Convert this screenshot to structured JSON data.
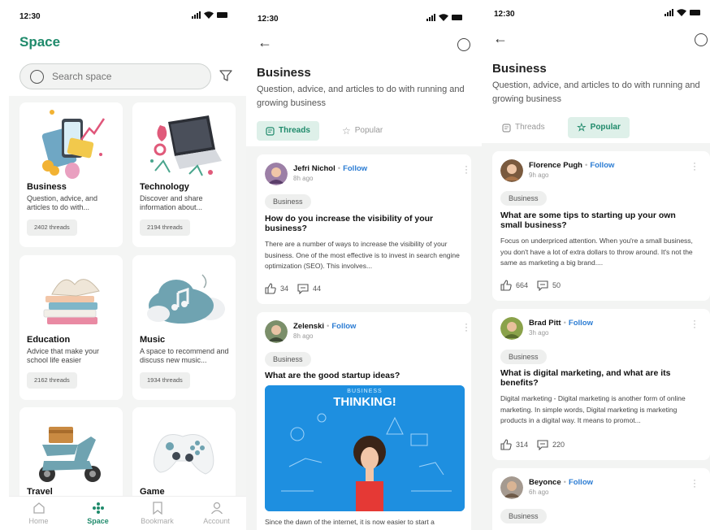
{
  "status_time": "12:30",
  "screen_space": {
    "title": "Space",
    "search_placeholder": "Search space",
    "cards": [
      {
        "title": "Business",
        "desc": "Question, advice, and articles to do with...",
        "threads": "2402 threads"
      },
      {
        "title": "Technology",
        "desc": "Discover and share information about...",
        "threads": "2194 threads"
      },
      {
        "title": "Education",
        "desc": "Advice that make your school life easier",
        "threads": "2162 threads"
      },
      {
        "title": "Music",
        "desc": "A space to recommend and discuss new music...",
        "threads": "1934 threads"
      },
      {
        "title": "Travel",
        "desc": "",
        "threads": ""
      },
      {
        "title": "Game",
        "desc": "",
        "threads": ""
      }
    ],
    "tabs": [
      {
        "label": "Home",
        "active": false
      },
      {
        "label": "Space",
        "active": true
      },
      {
        "label": "Bookmark",
        "active": false
      },
      {
        "label": "Account",
        "active": false
      }
    ]
  },
  "screen_threads": {
    "title": "Business",
    "subtitle": "Question, advice, and articles to do with running and growing business",
    "tab_threads": "Threads",
    "tab_popular": "Popular",
    "posts": [
      {
        "author": "Jefri Nichol",
        "follow": "Follow",
        "time": "8h ago",
        "tag": "Business",
        "title": "How do you increase the visibility of your business?",
        "body": "There are a number of ways to increase the visibility of your business. One of the most effective is to invest in search engine optimization (SEO). This involves...",
        "likes": "34",
        "comments": "44"
      },
      {
        "author": "Zelenski",
        "follow": "Follow",
        "time": "8h ago",
        "tag": "Business",
        "title": "What are the good startup ideas?",
        "image_caption": "BUSINESS",
        "image_heading": "THINKING!",
        "body": "Since the dawn of the internet, it is now easier to start a"
      }
    ]
  },
  "screen_popular": {
    "title": "Business",
    "subtitle": "Question, advice, and articles to do with running and growing business",
    "tab_threads": "Threads",
    "tab_popular": "Popular",
    "posts": [
      {
        "author": "Florence Pugh",
        "follow": "Follow",
        "time": "9h ago",
        "tag": "Business",
        "title": "What are some tips to starting up your own small business?",
        "body": "Focus on underpriced attention. When you're a small business, you don't have a lot of extra dollars to throw around. It's not the same as marketing a big brand....",
        "likes": "664",
        "comments": "50"
      },
      {
        "author": "Brad Pitt",
        "follow": "Follow",
        "time": "3h ago",
        "tag": "Business",
        "title": "What is digital marketing, and what are its benefits?",
        "body": "Digital marketing - Digital marketing is another form of online marketing. In simple words, Digital marketing is marketing products in a digital way. It means to promot...",
        "likes": "314",
        "comments": "220"
      },
      {
        "author": "Beyonce",
        "follow": "Follow",
        "time": "6h ago",
        "tag": "Business"
      }
    ]
  },
  "colors": {
    "accent": "#1f8a6b",
    "link": "#2b7cd3",
    "tab_bg": "#def0e9"
  }
}
